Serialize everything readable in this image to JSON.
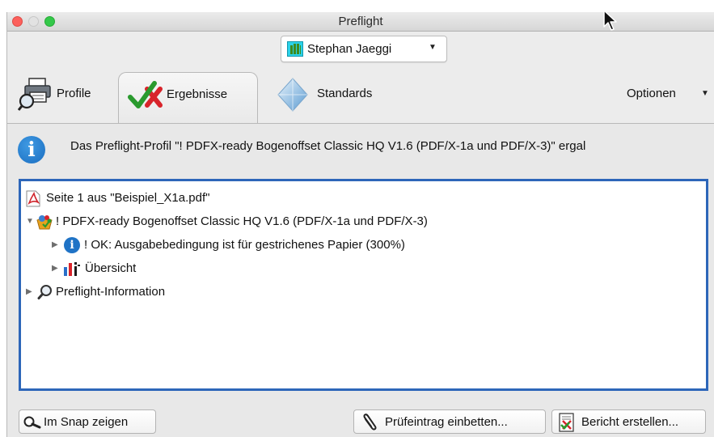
{
  "window": {
    "title": "Preflight"
  },
  "profile_selector": {
    "label": "Stephan Jaeggi"
  },
  "tabs": [
    {
      "label": "Profile"
    },
    {
      "label": "Ergebnisse",
      "active": true
    },
    {
      "label": "Standards"
    }
  ],
  "options_menu": {
    "label": "Optionen"
  },
  "info_message": "Das Preflight-Profil \"! PDFX-ready Bogenoffset Classic HQ V1.6 (PDF/X-1a und PDF/X-3)\" ergal",
  "tree": {
    "items": [
      {
        "label": "Seite 1 aus \"Beispiel_X1a.pdf\""
      },
      {
        "label": "! PDFX-ready Bogenoffset Classic HQ V1.6 (PDF/X-1a und PDF/X-3)",
        "expanded": true
      },
      {
        "label": "! OK: Ausgabebedingung ist für gestrichenes Papier (300%)",
        "expanded": false
      },
      {
        "label": "Übersicht",
        "expanded": false
      },
      {
        "label": "Preflight-Information",
        "expanded": false
      }
    ]
  },
  "buttons": {
    "snap": "Im Snap zeigen",
    "embed": "Prüfeintrag einbetten...",
    "report": "Bericht erstellen..."
  },
  "colors": {
    "selection_border": "#2d66b9",
    "info_blue": "#1b6dc0",
    "check_green": "#2a9a2e",
    "cross_red": "#d8242b"
  }
}
